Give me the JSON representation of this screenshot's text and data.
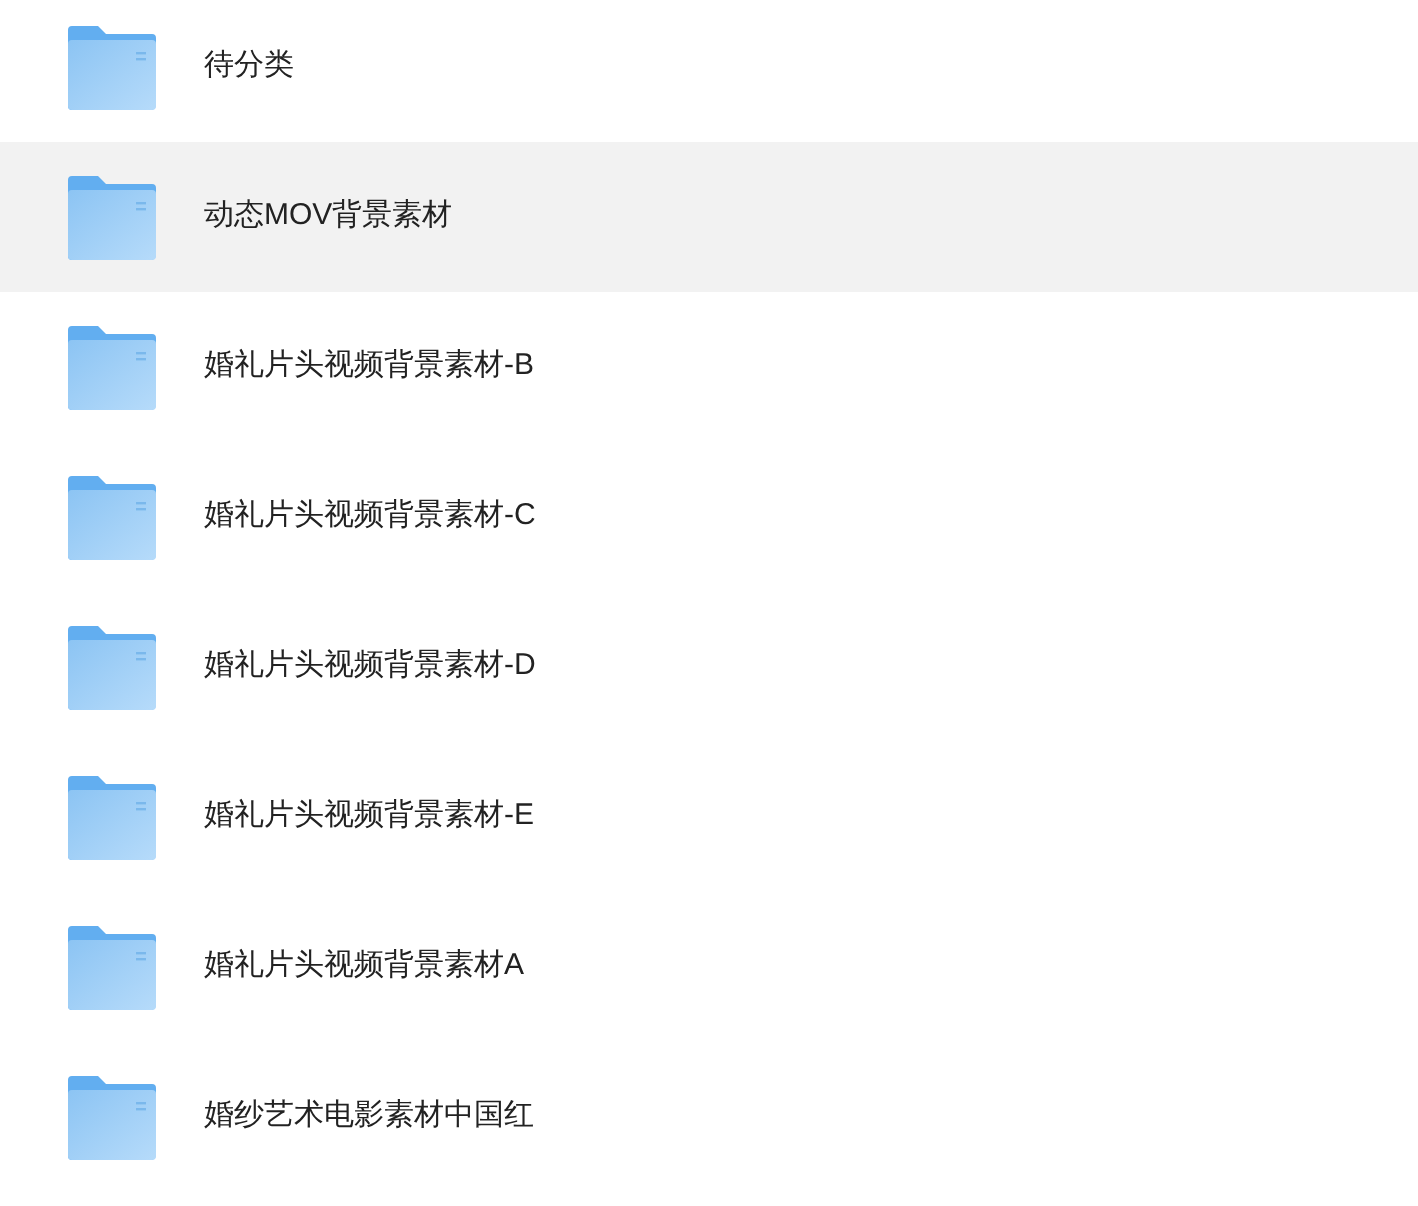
{
  "folders": [
    {
      "name": "待分类",
      "selected": false
    },
    {
      "name": "动态MOV背景素材",
      "selected": true
    },
    {
      "name": "婚礼片头视频背景素材-B",
      "selected": false
    },
    {
      "name": "婚礼片头视频背景素材-C",
      "selected": false
    },
    {
      "name": "婚礼片头视频背景素材-D",
      "selected": false
    },
    {
      "name": "婚礼片头视频背景素材-E",
      "selected": false
    },
    {
      "name": "婚礼片头视频背景素材A",
      "selected": false
    },
    {
      "name": "婚纱艺术电影素材中国红",
      "selected": false
    }
  ]
}
